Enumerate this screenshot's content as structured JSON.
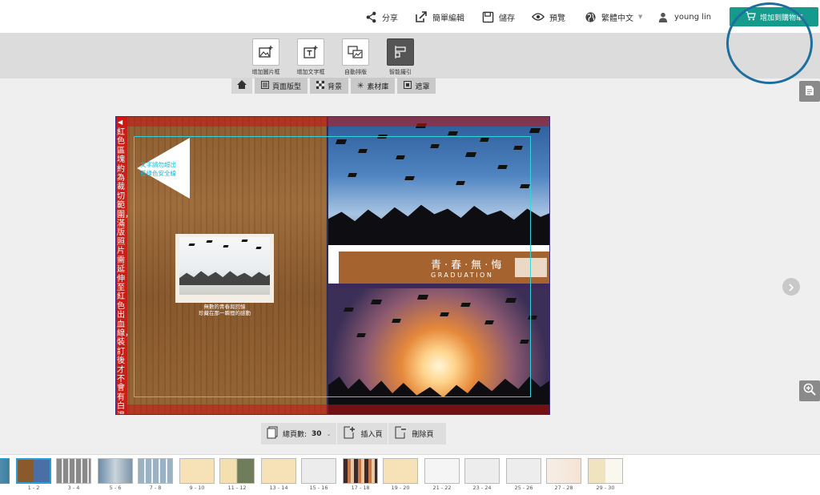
{
  "header": {
    "share_label": "分享",
    "simple_edit_label": "簡單編輯",
    "save_label": "儲存",
    "preview_label": "預覽",
    "language_label": "繁體中文",
    "user_name": "young lin",
    "cart_label": "增加到購物車"
  },
  "tools": {
    "add_image_frame": "增加圖片框",
    "add_text_frame": "增加文字框",
    "auto_layout": "自動排版",
    "smart_guides": "智能撮引"
  },
  "subtabs": {
    "page_layout": "頁面版型",
    "background": "背景",
    "materials": "素材庫",
    "mask": "遮罩"
  },
  "canvas": {
    "bleed_note": "紅色區塊約為裁切範圍，滿版照片需延伸至紅色出血線，裝訂後才不會有白邊",
    "callout_line1": "文字請勿超出",
    "callout_line2": "藍綠色安全線",
    "left_caption_line1": "無數的青春與回憶",
    "left_caption_line2": "珍藏在那一瞬間的感動",
    "title_zh": "青·春·無·悔",
    "title_en": "GRADUATION"
  },
  "page_controls": {
    "total_pages_label": "總頁數:",
    "total_pages_value": "30",
    "insert_page": "插入頁",
    "delete_page": "刪除頁"
  },
  "thumbnails": [
    {
      "label": "1 - 2"
    },
    {
      "label": "3 - 4"
    },
    {
      "label": "5 - 6"
    },
    {
      "label": "7 - 8"
    },
    {
      "label": "9 - 10"
    },
    {
      "label": "11 - 12"
    },
    {
      "label": "13 - 14"
    },
    {
      "label": "15 - 16"
    },
    {
      "label": "17 - 18"
    },
    {
      "label": "19 - 20"
    },
    {
      "label": "21 - 22"
    },
    {
      "label": "23 - 24"
    },
    {
      "label": "25 - 26"
    },
    {
      "label": "27 - 28"
    },
    {
      "label": "29 - 30"
    }
  ],
  "colors": {
    "accent": "#169a8c",
    "annotation_ring": "#1d6f9e",
    "bleed_red": "#d21414",
    "safe_line": "#34d4dc",
    "banner_brown": "#a5632f"
  }
}
